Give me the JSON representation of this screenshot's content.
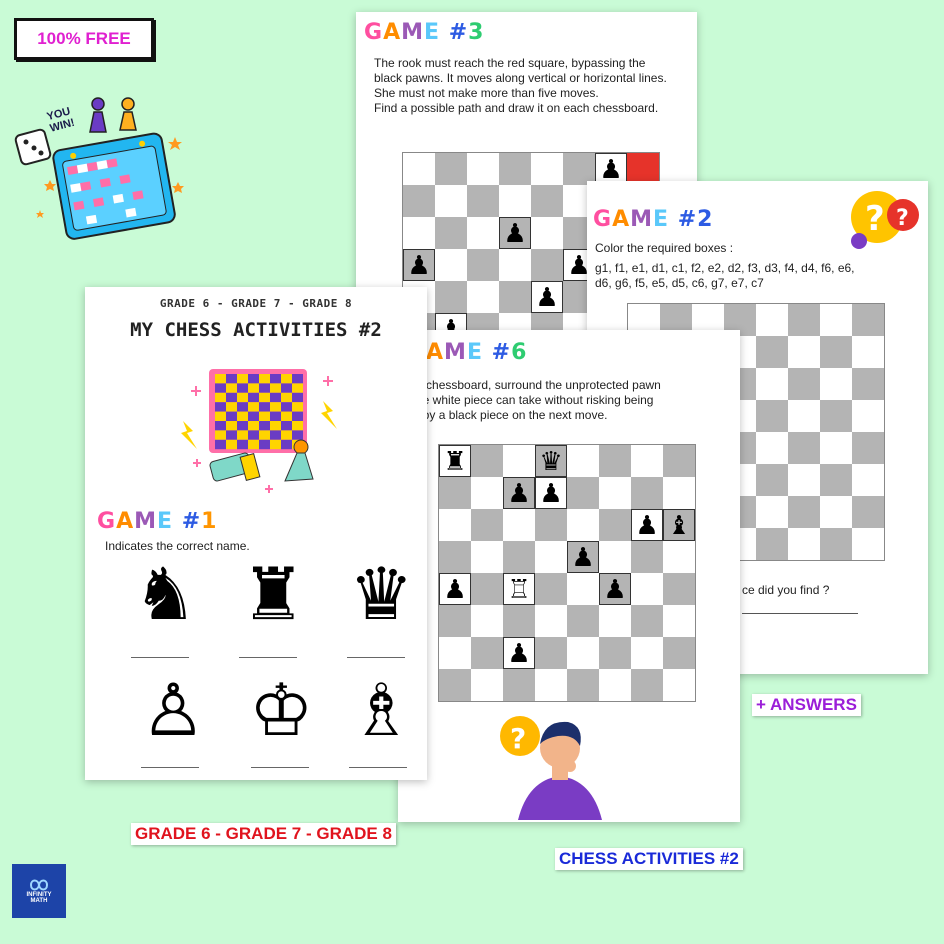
{
  "badge_free": "100% FREE",
  "sticker": {
    "you_win": "YOU WIN!"
  },
  "game3": {
    "title_parts": [
      "G",
      "A",
      "M",
      "E",
      " #",
      "3"
    ],
    "lines": [
      "The rook must reach the red square, bypassing the",
      "black pawns. It moves along vertical or horizontal lines.",
      "She must not make more than five moves.",
      "Find a possible path and draw it on each chessboard."
    ]
  },
  "game2": {
    "title_parts": [
      "G",
      "A",
      "M",
      "E",
      " #",
      "2"
    ],
    "instruction": "Color the required boxes :",
    "squares_line1": "g1, f1, e1, d1, c1, f2, e2, d2, f3, d3, f4, d4, f6, e6,",
    "squares_line2": "d6, g6, f5, e5, d5, c6, g7, e7, c7"
  },
  "game6": {
    "title_parts": [
      "A",
      "M",
      "E",
      " #",
      "6"
    ],
    "lines": [
      "the chessboard, surround the unprotected pawn",
      "t the white piece can take without risking being",
      "en by a black piece on the next move."
    ],
    "question": "ce did you find ?"
  },
  "sheet1": {
    "grades_header": "GRADE 6 - GRADE 7 - GRADE 8",
    "title": "MY CHESS ACTIVITIES #2",
    "game1_title_parts": [
      "G",
      "A",
      "M",
      "E",
      " #",
      "1"
    ],
    "game1_instruction": "Indicates the correct name.",
    "pieces_row1": [
      "♞",
      "♜",
      "♛"
    ],
    "pieces_row2": [
      "♙",
      "♔",
      "♗"
    ]
  },
  "answers_label": "+     ANSWERS",
  "grades_label": "GRADE 6 - GRADE 7 - GRADE 8",
  "chess_label": "CHESS ACTIVITIES #2",
  "logo": {
    "line1": "INFINITY",
    "line2": "MATH"
  },
  "colors": {
    "background": "#c9fbd6",
    "red_label": "#e0141e",
    "blue_label": "#1a2ad8",
    "purple_label": "#9b1ed8",
    "badge_text": "#e020d0"
  },
  "board3_pieces": [
    [
      0,
      6,
      "♟"
    ],
    [
      0,
      7,
      "red"
    ],
    [
      2,
      3,
      "♟"
    ],
    [
      3,
      0,
      "♟"
    ],
    [
      3,
      5,
      "♟"
    ],
    [
      4,
      4,
      "♟"
    ],
    [
      5,
      1,
      "♟"
    ]
  ],
  "board6_pieces": [
    [
      0,
      0,
      "♜"
    ],
    [
      0,
      3,
      "♛"
    ],
    [
      1,
      2,
      "♟"
    ],
    [
      1,
      3,
      "♟"
    ],
    [
      2,
      6,
      "♟"
    ],
    [
      2,
      7,
      "♝"
    ],
    [
      3,
      4,
      "♟"
    ],
    [
      4,
      0,
      "♟"
    ],
    [
      4,
      2,
      "♖"
    ],
    [
      4,
      5,
      "♟"
    ],
    [
      6,
      2,
      "♟"
    ]
  ]
}
